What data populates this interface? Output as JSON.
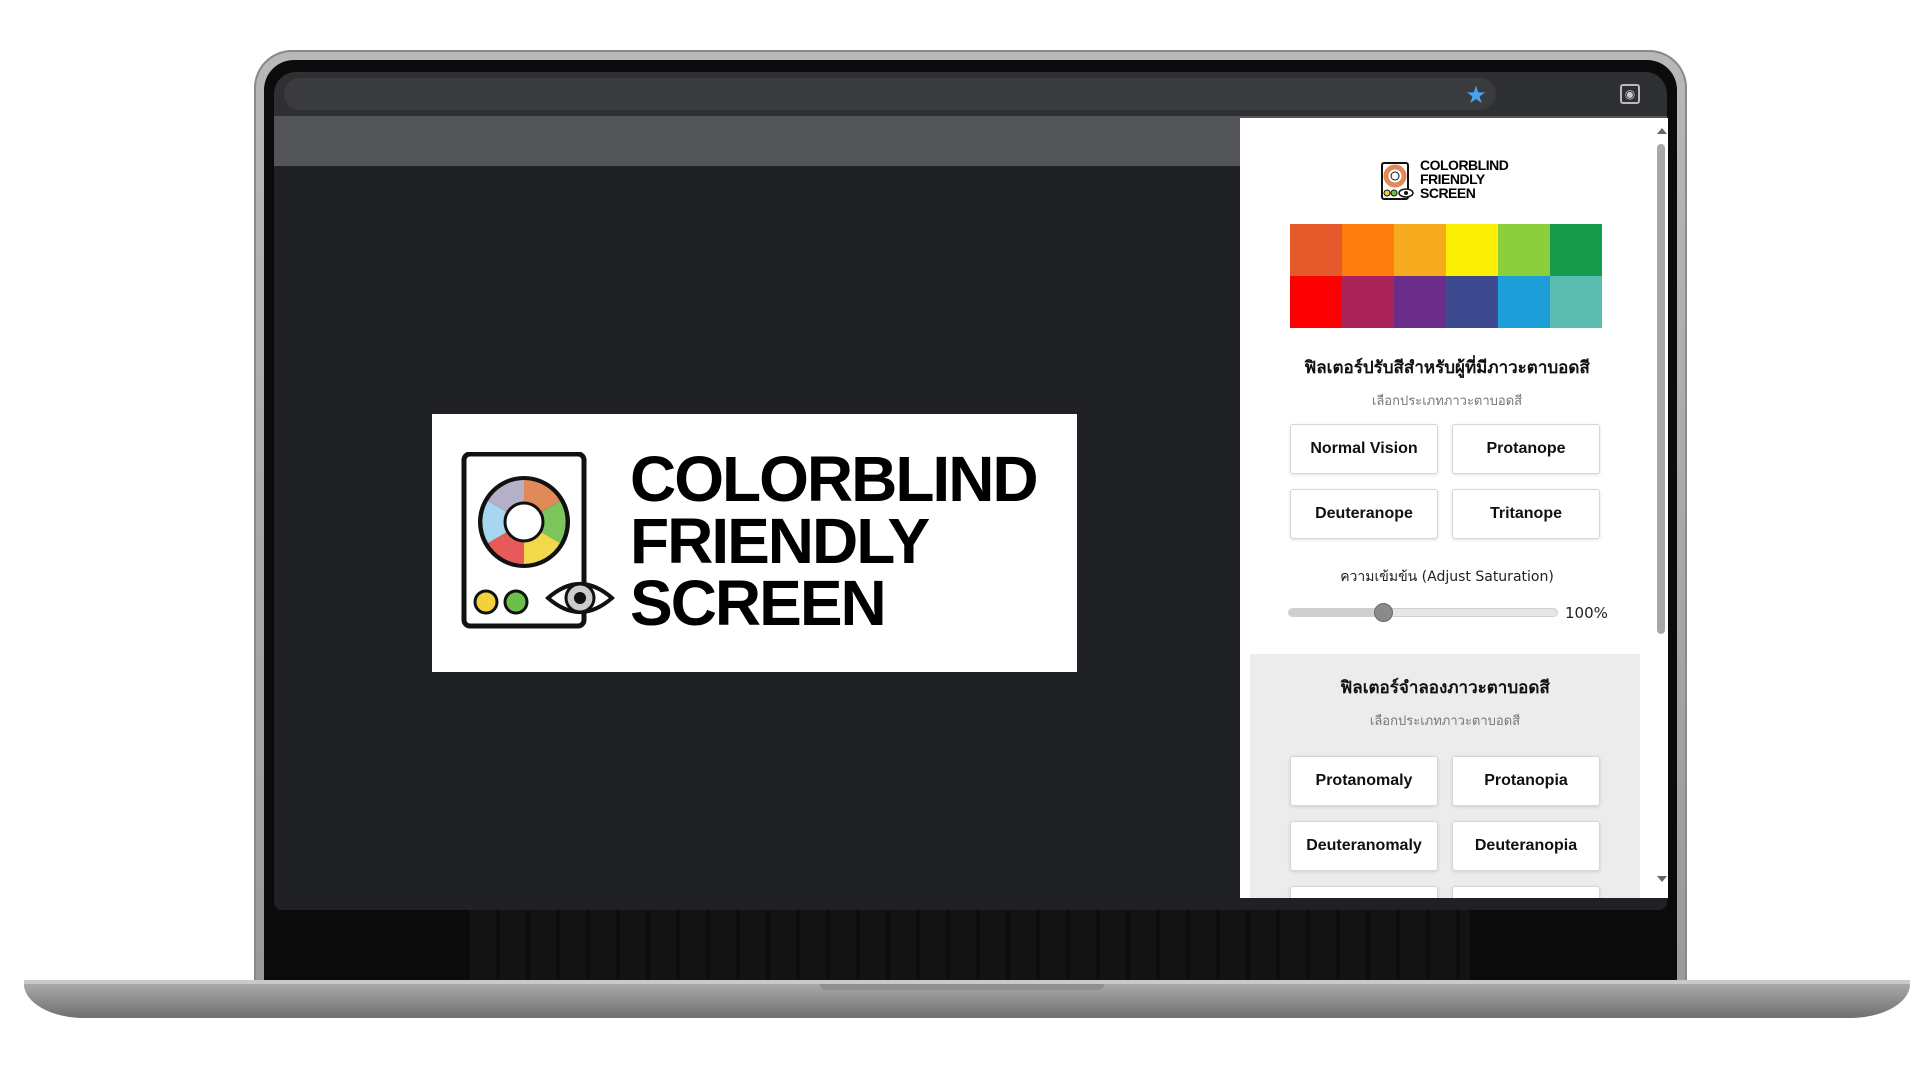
{
  "hero": {
    "line1": "COLORBLIND",
    "line2": "FRIENDLY",
    "line3": "SCREEN"
  },
  "popup": {
    "logo": {
      "line1": "COLORBLIND",
      "line2": "FRIENDLY",
      "line3": "SCREEN"
    },
    "swatches": [
      "#e55a2b",
      "#fe7d0c",
      "#f6ab1f",
      "#fcf104",
      "#8ccf3d",
      "#149a4a",
      "#fd0002",
      "#ab2459",
      "#6b2c8a",
      "#3d4a8f",
      "#1d9ed8",
      "#5bbcb0"
    ],
    "adjust": {
      "title": "ฟิลเตอร์ปรับสีสำหรับผู้ที่มีภาวะตาบอดสี",
      "subtitle": "เลือกประเภทภาวะตาบอดสี",
      "buttons": [
        "Normal Vision",
        "Protanope",
        "Deuteranope",
        "Tritanope"
      ],
      "saturation_label": "ความเข้มข้น (Adjust Saturation)",
      "saturation_value": "100%",
      "saturation_slider_fraction": 0.35
    },
    "simulate": {
      "title": "ฟิลเตอร์จำลองภาวะตาบอดสี",
      "subtitle": "เลือกประเภทภาวะตาบอดสี",
      "buttons": [
        "Protanomaly",
        "Protanopia",
        "Deuteranomaly",
        "Deuteranopia"
      ]
    }
  },
  "colors": {
    "accent_star": "#4aa3f0",
    "screen_bg": "#202124",
    "bookmark_bar": "#545558"
  },
  "icons": {
    "star": "bookmark-star-icon",
    "extension": "extension-icon"
  }
}
